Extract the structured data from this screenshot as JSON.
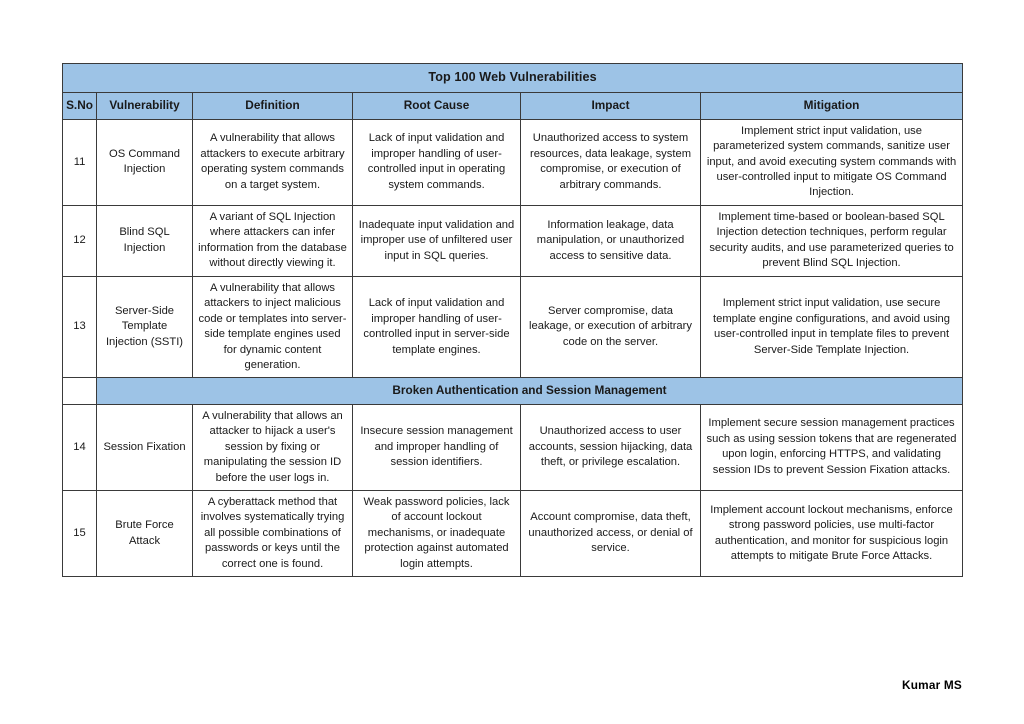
{
  "document": {
    "title": "Top 100  Web Vulnerabilities",
    "footer_credit": "Kumar MS",
    "accent_color": "#9DC3E6",
    "border_color": "#3a3a3a",
    "text_color": "#1a1a1a"
  },
  "table": {
    "columns": [
      {
        "key": "sno",
        "label": "S.No"
      },
      {
        "key": "vulnerability",
        "label": "Vulnerability"
      },
      {
        "key": "definition",
        "label": "Definition"
      },
      {
        "key": "root_cause",
        "label": "Root Cause"
      },
      {
        "key": "impact",
        "label": "Impact"
      },
      {
        "key": "mitigation",
        "label": "Mitigation"
      }
    ],
    "rows": [
      {
        "type": "data",
        "sno": "11",
        "vulnerability": "OS Command Injection",
        "definition": "A vulnerability that allows attackers to execute arbitrary operating system commands on a target system.",
        "root_cause": "Lack of input validation and improper handling of user-controlled input in operating system commands.",
        "impact": "Unauthorized access to system resources, data leakage, system compromise, or execution of arbitrary commands.",
        "mitigation": "Implement strict input validation, use parameterized system commands, sanitize user input, and avoid executing system commands with user-controlled input to mitigate OS Command Injection."
      },
      {
        "type": "data",
        "sno": "12",
        "vulnerability": "Blind SQL Injection",
        "definition": "A variant of SQL Injection where attackers can infer information from the database without directly viewing it.",
        "root_cause": "Inadequate input validation and improper use of unfiltered user input in SQL queries.",
        "impact": "Information leakage, data manipulation, or unauthorized access to sensitive data.",
        "mitigation": "Implement time-based or boolean-based SQL Injection detection techniques, perform regular security audits, and use parameterized queries to prevent Blind SQL Injection."
      },
      {
        "type": "data",
        "sno": "13",
        "vulnerability": "Server-Side Template Injection (SSTI)",
        "definition": "A vulnerability that allows attackers to inject malicious code or templates into server-side template engines used for dynamic content generation.",
        "root_cause": "Lack of input validation and improper handling of user-controlled input in server-side template engines.",
        "impact": "Server compromise, data leakage, or execution of arbitrary code on the server.",
        "mitigation": "Implement strict input validation, use secure template engine configurations, and avoid using user-controlled input in template files to prevent Server-Side Template Injection."
      },
      {
        "type": "section",
        "sno": "",
        "section_label": "Broken Authentication and Session Management"
      },
      {
        "type": "data",
        "sno": "14",
        "vulnerability": "Session Fixation",
        "definition": "A vulnerability that allows an attacker to hijack a user's session by fixing or manipulating the session ID before the user logs in.",
        "root_cause": "Insecure session management and improper handling of session identifiers.",
        "impact": "Unauthorized access to user accounts, session hijacking, data theft, or privilege escalation.",
        "mitigation": "Implement secure session management practices such as using session tokens that are regenerated upon login, enforcing HTTPS, and validating session IDs to prevent Session Fixation attacks."
      },
      {
        "type": "data",
        "sno": "15",
        "vulnerability": "Brute Force Attack",
        "definition": "A cyberattack method that involves systematically trying all possible combinations of passwords or keys until the correct one is found.",
        "root_cause": "Weak password policies, lack of account lockout mechanisms, or inadequate protection against automated login attempts.",
        "impact": "Account compromise, data theft, unauthorized access, or denial of service.",
        "mitigation": "Implement account lockout mechanisms, enforce strong password policies, use multi-factor authentication, and monitor for suspicious login attempts to mitigate Brute Force Attacks."
      }
    ]
  }
}
